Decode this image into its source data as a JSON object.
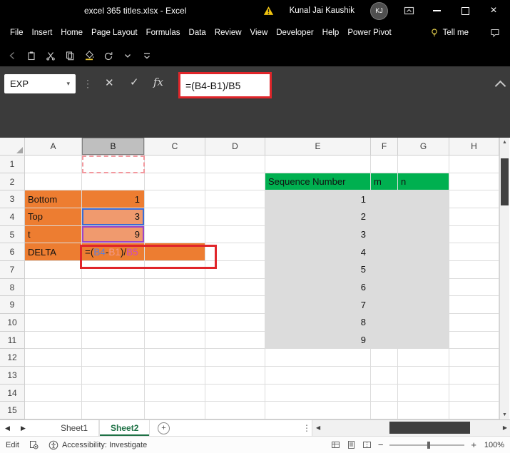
{
  "title_bar": {
    "title": "excel 365 titles.xlsx  -  Excel",
    "user_name": "Kunal Jai Kaushik",
    "avatar_initials": "KJ"
  },
  "ribbon": {
    "tabs": [
      "File",
      "Insert",
      "Home",
      "Page Layout",
      "Formulas",
      "Data",
      "Review",
      "View",
      "Developer",
      "Help",
      "Power Pivot"
    ],
    "tell_me": "Tell me"
  },
  "formula_bar": {
    "name_box_value": "EXP",
    "cancel_glyph": "✕",
    "enter_glyph": "✓",
    "fx_label": "fx",
    "formula": "=(B4-B1)/B5"
  },
  "sheet": {
    "col_headers": [
      "A",
      "B",
      "C",
      "D",
      "E",
      "F",
      "G",
      "H"
    ],
    "row_count": 15,
    "selected_column": "B",
    "values": {
      "A3": "Bottom",
      "B3": "1",
      "A4": "Top",
      "B4": "3",
      "A5": "t",
      "B5": "9",
      "A6": "DELTA",
      "E2": "Sequence Number",
      "F2": "m",
      "G2": "n",
      "E3": "1",
      "E4": "2",
      "E5": "3",
      "E6": "4",
      "E7": "5",
      "E8": "6",
      "E9": "7",
      "E10": "8",
      "E11": "9"
    },
    "orange_cells": [
      "A3",
      "B3",
      "A4",
      "A5",
      "A6",
      "C6"
    ],
    "orange_tint_cells": [
      "B4",
      "B5"
    ],
    "green_cells": [
      "E2",
      "F2",
      "G2"
    ],
    "gray_region": {
      "cols": [
        "E",
        "F",
        "G"
      ],
      "row_start": 3,
      "row_end": 11
    },
    "reference_highlights": [
      {
        "cell": "B4",
        "style": "blue"
      },
      {
        "cell": "B5",
        "style": "purple"
      },
      {
        "cell": "B1",
        "style": "red-dashed"
      }
    ],
    "editing_cell": {
      "ref": "B6",
      "parts": [
        {
          "text": "=(",
          "color": "black"
        },
        {
          "text": "B4",
          "color": "blue"
        },
        {
          "text": "-",
          "color": "black"
        },
        {
          "text": "B1",
          "color": "red"
        },
        {
          "text": ")/",
          "color": "black"
        },
        {
          "text": "B5",
          "color": "purple"
        }
      ]
    }
  },
  "sheet_tabs": {
    "tabs": [
      {
        "label": "Sheet1",
        "active": false
      },
      {
        "label": "Sheet2",
        "active": true
      }
    ]
  },
  "status_bar": {
    "mode": "Edit",
    "accessibility": "Accessibility: Investigate",
    "zoom": "100%"
  },
  "colors": {
    "orange_fill": "#ED7D31",
    "green_fill": "#00B050",
    "gray_fill": "#DCDCDC",
    "annotation_red": "#E0252A",
    "active_tab_green": "#1E7145"
  }
}
